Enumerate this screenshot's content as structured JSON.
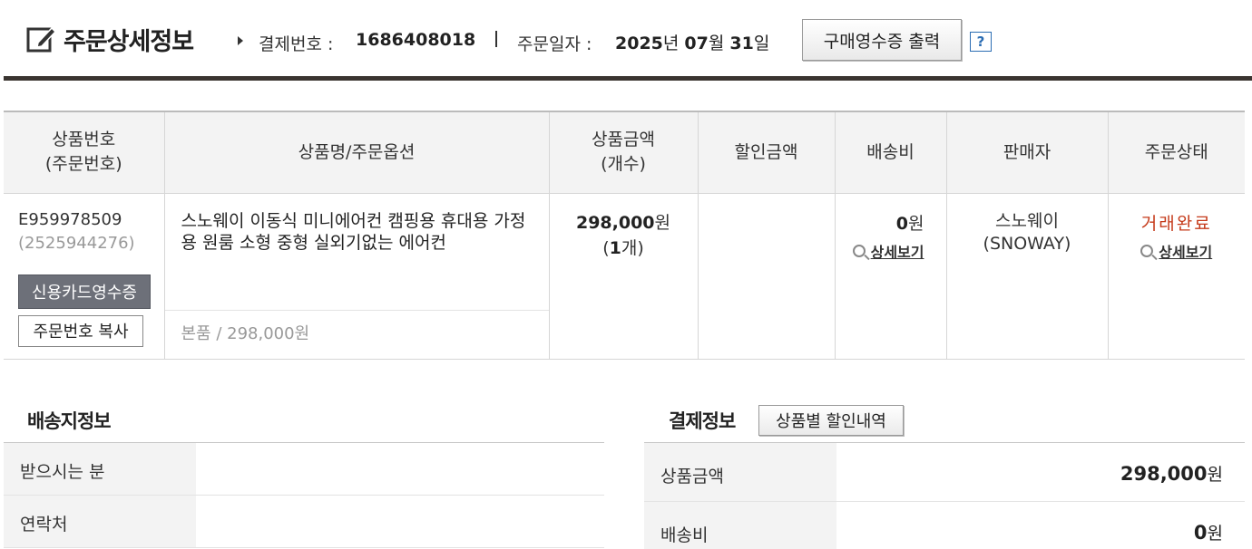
{
  "header": {
    "title": "주문상세정보",
    "pay_label": "결제번호 :",
    "pay_number": "1686408018",
    "date_label": "주문일자 :",
    "date": {
      "year": "2025",
      "year_unit": "년 ",
      "month": "07",
      "month_unit": "월 ",
      "day": "31",
      "day_unit": "일"
    },
    "receipt_button": "구매영수증 출력",
    "help_button": "?"
  },
  "order_table": {
    "columns": {
      "no_1": "상품번호",
      "no_2": "(주문번호)",
      "name": "상품명/주문옵션",
      "price_1": "상품금액",
      "price_2": "(개수)",
      "discount": "할인금액",
      "shipping": "배송비",
      "seller": "판매자",
      "status": "주문상태"
    },
    "row": {
      "product_code": "E959978509",
      "order_code": "(2525944276)",
      "card_receipt_button": "신용카드영수증",
      "copy_button": "주문번호 복사",
      "product_name": "스노웨이 이동식 미니에어컨 캠핑용 휴대용 가정용 원룸 소형 중형 실외기없는 에어컨",
      "option": "본품 / 298,000원",
      "price": "298,000",
      "price_unit": "원",
      "qty_open": "(",
      "qty": "1",
      "qty_close": "개)",
      "discount": "",
      "shipping": "0",
      "shipping_unit": "원",
      "shipping_detail": "상세보기",
      "seller_name": "스노웨이",
      "seller_en": "(SNOWAY)",
      "status": "거래완료",
      "status_detail": "상세보기"
    }
  },
  "shipping_info": {
    "title": "배송지정보",
    "rows": [
      {
        "label": "받으시는 분",
        "value": ""
      },
      {
        "label": "연락처",
        "value": ""
      }
    ]
  },
  "payment_info": {
    "title": "결제정보",
    "discount_button": "상품별 할인내역",
    "rows": [
      {
        "label": "상품금액",
        "value": "298,000",
        "unit": "원"
      },
      {
        "label": "배송비",
        "value": "0",
        "unit": "원"
      }
    ]
  },
  "colors": {
    "status": "#c53a1a",
    "rule": "#3a3430",
    "card_button": "#6d7079",
    "help": "#2b6db3"
  }
}
